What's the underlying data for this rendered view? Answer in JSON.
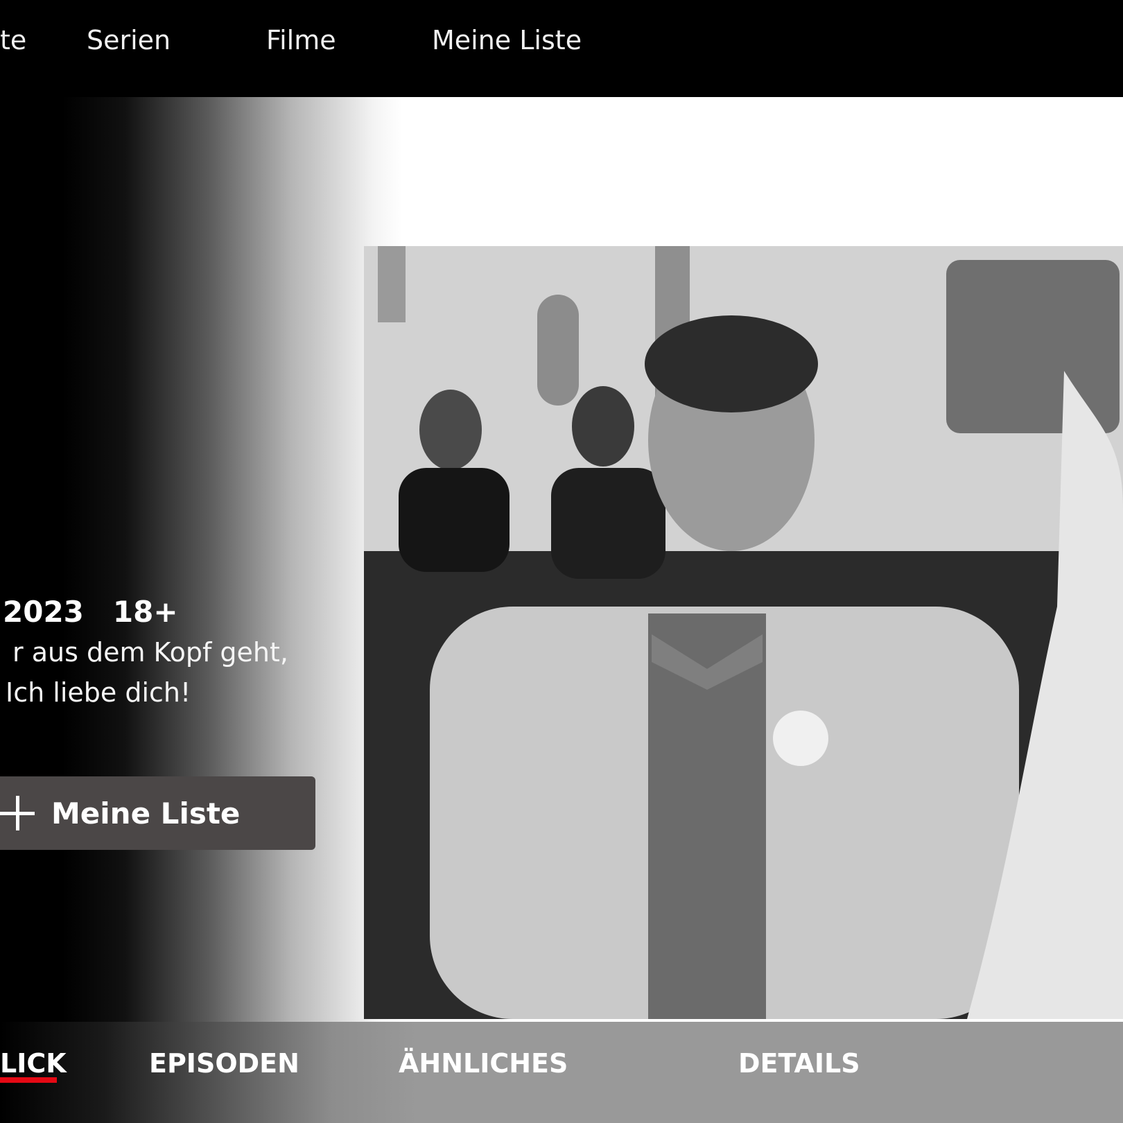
{
  "nav": {
    "items": [
      {
        "label": "te"
      },
      {
        "label": "Serien"
      },
      {
        "label": "Filme"
      },
      {
        "label": "Meine Liste"
      }
    ]
  },
  "hero": {
    "meta": {
      "year": "2023",
      "rating": "18+"
    },
    "description": [
      "r aus dem Kopf geht,",
      "Ich liebe dich!"
    ],
    "list_button": {
      "label": "Meine Liste",
      "icon": "plus-icon"
    }
  },
  "tabs": {
    "items": [
      {
        "label": "LICK",
        "active": true
      },
      {
        "label": "EPISODEN"
      },
      {
        "label": "ÄHNLICHES"
      },
      {
        "label": "DETAILS"
      }
    ],
    "active_color": "#e50914"
  }
}
